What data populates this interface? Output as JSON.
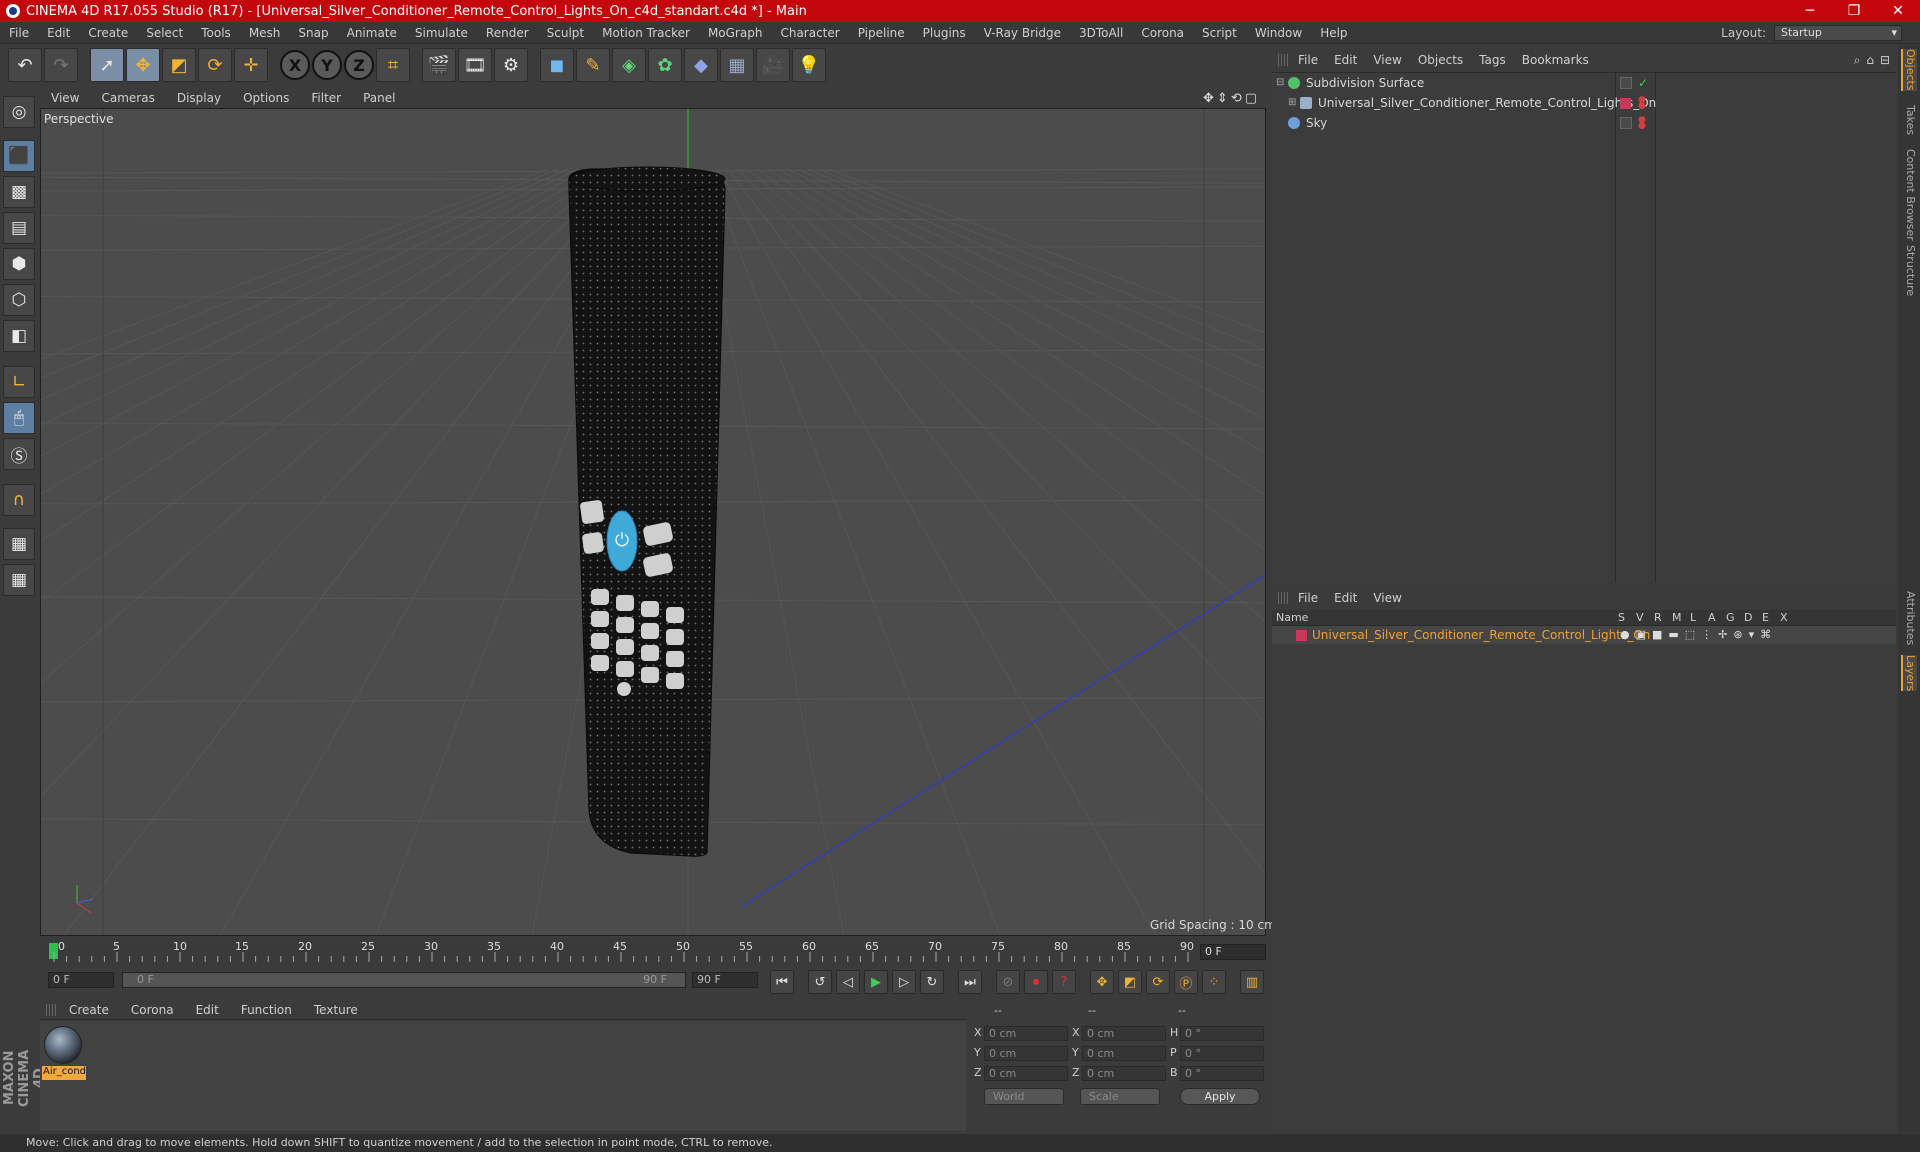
{
  "window": {
    "title": "CINEMA 4D R17.055 Studio (R17) - [Universal_Silver_Conditioner_Remote_Control_Lights_On_c4d_standart.c4d *] - Main",
    "controls": [
      "─",
      "❐",
      "✕"
    ]
  },
  "menubar": {
    "items": [
      "File",
      "Edit",
      "Create",
      "Select",
      "Tools",
      "Mesh",
      "Snap",
      "Animate",
      "Simulate",
      "Render",
      "Sculpt",
      "Motion Tracker",
      "MoGraph",
      "Character",
      "Pipeline",
      "Plugins",
      "V-Ray Bridge",
      "3DToAll",
      "Corona",
      "Script",
      "Window",
      "Help"
    ],
    "layout_label": "Layout:",
    "layout_value": "Startup"
  },
  "toolbar": {
    "axis_x": "X",
    "axis_y": "Y",
    "axis_z": "Z"
  },
  "viewport": {
    "menu": [
      "View",
      "Cameras",
      "Display",
      "Options",
      "Filter",
      "Panel"
    ],
    "label": "Perspective",
    "grid_spacing": "Grid Spacing : 10 cm",
    "nav_icons": "✥⇕⟲▢",
    "colors": {
      "background": "#4c4c4c",
      "grid": "#5c5c5c",
      "object": "#141414",
      "power_button": "#3fa9d8"
    }
  },
  "timeline": {
    "ticks": [
      "0",
      "5",
      "10",
      "15",
      "20",
      "25",
      "30",
      "35",
      "40",
      "45",
      "50",
      "55",
      "60",
      "65",
      "70",
      "75",
      "80",
      "85",
      "90"
    ],
    "current_frame": "0 F",
    "start_field": "0 F",
    "range_start": "0 F",
    "range_end": "90 F",
    "end_field": "90 F"
  },
  "material_manager": {
    "menu": [
      "Create",
      "Corona",
      "Edit",
      "Function",
      "Texture"
    ],
    "material_name": "Air_cond"
  },
  "coordinates": {
    "header": [
      "--",
      "--",
      "--"
    ],
    "rows": [
      {
        "pos_label": "X",
        "pos": "0 cm",
        "size_label": "X",
        "size": "0 cm",
        "rot_label": "H",
        "rot": "0 °"
      },
      {
        "pos_label": "Y",
        "pos": "0 cm",
        "size_label": "Y",
        "size": "0 cm",
        "rot_label": "P",
        "rot": "0 °"
      },
      {
        "pos_label": "Z",
        "pos": "0 cm",
        "size_label": "Z",
        "size": "0 cm",
        "rot_label": "B",
        "rot": "0 °"
      }
    ],
    "mode_world": "World",
    "mode_scale": "Scale",
    "apply": "Apply"
  },
  "object_manager": {
    "menu": [
      "File",
      "Edit",
      "View",
      "Objects",
      "Tags",
      "Bookmarks"
    ],
    "objects": [
      {
        "name": "Subdivision Surface",
        "icon_color": "#4fc36a"
      },
      {
        "name": "Universal_Silver_Conditioner_Remote_Control_Lights_On",
        "icon_color": "#9ab0c8"
      },
      {
        "name": "Sky",
        "icon_color": "#6ca0d8"
      }
    ]
  },
  "layer_manager": {
    "menu": [
      "File",
      "Edit",
      "View"
    ],
    "columns": [
      "Name",
      "S",
      "V",
      "R",
      "M",
      "L",
      "A",
      "G",
      "D",
      "E",
      "X"
    ],
    "layers": [
      {
        "name": "Universal_Silver_Conditioner_Remote_Control_Lights_On",
        "color": "#c8385a"
      }
    ]
  },
  "right_tabs": [
    "Objects",
    "Takes",
    "Content Browser",
    "Structure",
    "Attributes",
    "Layers"
  ],
  "status": "Move: Click and drag to move elements. Hold down SHIFT to quantize movement / add to the selection in point mode, CTRL to remove.",
  "brand": "MAXON CINEMA 4D"
}
